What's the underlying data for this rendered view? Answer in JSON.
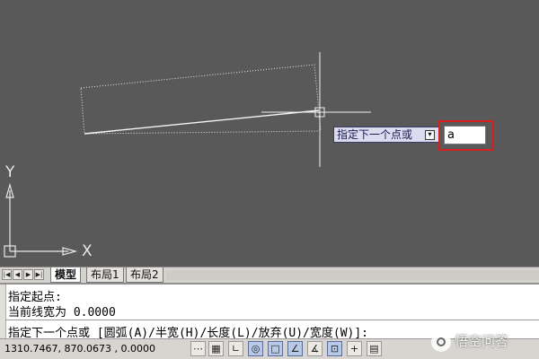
{
  "canvas": {
    "prompt_tooltip": "指定下一个点或",
    "prompt_options_glyph": "▾",
    "input_value": "a",
    "ucs": {
      "y_label": "Y",
      "x_label": "X"
    }
  },
  "layout_tabs": {
    "nav": [
      "|◀",
      "◀",
      "▶",
      "▶|"
    ],
    "tabs": [
      "模型",
      "布局1",
      "布局2"
    ],
    "active_tab": "模型"
  },
  "command_line": {
    "history": [
      "指定起点:",
      "当前线宽为 0.0000"
    ],
    "current_prompt": "指定下一个点或 [圆弧(A)/半宽(H)/长度(L)/放弃(U)/宽度(W)]:"
  },
  "status_bar": {
    "coordinates": "1310.7467, 870.0673 , 0.0000",
    "buttons": [
      {
        "name": "snap-toggle",
        "glyph": "⋯"
      },
      {
        "name": "grid-toggle",
        "glyph": "▦"
      },
      {
        "name": "ortho-toggle",
        "glyph": "∟"
      },
      {
        "name": "polar-toggle",
        "glyph": "◎"
      },
      {
        "name": "osnap-toggle",
        "glyph": "□"
      },
      {
        "name": "otrack-toggle",
        "glyph": "∠"
      },
      {
        "name": "ducs-toggle",
        "glyph": "∡"
      },
      {
        "name": "dyn-toggle",
        "glyph": "⊡"
      },
      {
        "name": "lwt-toggle",
        "glyph": "+"
      },
      {
        "name": "qp-toggle",
        "glyph": "▤"
      }
    ]
  },
  "watermark": {
    "text": "悟空问答"
  },
  "colors": {
    "canvas_bg": "#595959",
    "highlight": "#d81e1e",
    "tooltip_bg": "#dcdcf0"
  }
}
